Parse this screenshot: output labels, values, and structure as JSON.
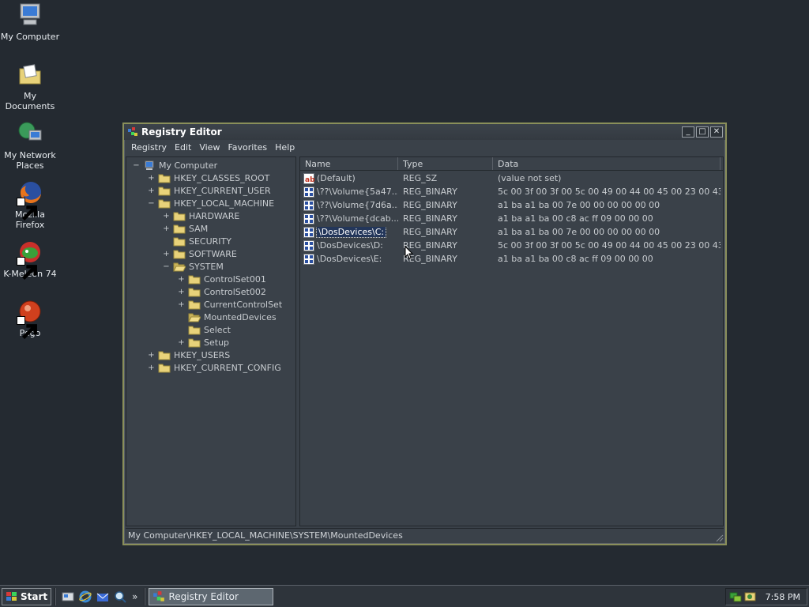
{
  "desktop": {
    "icons": [
      {
        "label": "My Computer",
        "icon": "my-computer-icon"
      },
      {
        "label": "My Documents",
        "icon": "my-documents-icon"
      },
      {
        "label": "My Network Places",
        "icon": "my-network-places-icon"
      },
      {
        "label": "Mozilla Firefox",
        "icon": "firefox-icon"
      },
      {
        "label": "K-Meleon 74",
        "icon": "k-meleon-icon"
      },
      {
        "label": "Pego",
        "icon": "pego-icon"
      }
    ]
  },
  "window": {
    "title": "Registry Editor",
    "menu": [
      "Registry",
      "Edit",
      "View",
      "Favorites",
      "Help"
    ],
    "tree": [
      {
        "label": "My Computer",
        "expander": "−",
        "icon": "computer-icon"
      },
      {
        "label": "HKEY_CLASSES_ROOT",
        "expander": "+",
        "icon": "folder-icon"
      },
      {
        "label": "HKEY_CURRENT_USER",
        "expander": "+",
        "icon": "folder-icon"
      },
      {
        "label": "HKEY_LOCAL_MACHINE",
        "expander": "−",
        "icon": "folder-icon"
      },
      {
        "label": "HARDWARE",
        "expander": "+",
        "icon": "folder-icon"
      },
      {
        "label": "SAM",
        "expander": "+",
        "icon": "folder-icon"
      },
      {
        "label": "SECURITY",
        "expander": "",
        "icon": "folder-icon"
      },
      {
        "label": "SOFTWARE",
        "expander": "+",
        "icon": "folder-icon"
      },
      {
        "label": "SYSTEM",
        "expander": "−",
        "icon": "folder-open-icon"
      },
      {
        "label": "ControlSet001",
        "expander": "+",
        "icon": "folder-icon"
      },
      {
        "label": "ControlSet002",
        "expander": "+",
        "icon": "folder-icon"
      },
      {
        "label": "CurrentControlSet",
        "expander": "+",
        "icon": "folder-icon"
      },
      {
        "label": "MountedDevices",
        "expander": "",
        "icon": "folder-open-icon"
      },
      {
        "label": "Select",
        "expander": "",
        "icon": "folder-icon"
      },
      {
        "label": "Setup",
        "expander": "+",
        "icon": "folder-icon"
      },
      {
        "label": "HKEY_USERS",
        "expander": "+",
        "icon": "folder-icon"
      },
      {
        "label": "HKEY_CURRENT_CONFIG",
        "expander": "+",
        "icon": "folder-icon"
      }
    ],
    "columns": {
      "name": "Name",
      "type": "Type",
      "data": "Data"
    },
    "values": [
      {
        "name": "(Default)",
        "type": "REG_SZ",
        "data": "(value not set)",
        "icon": "string-value-icon"
      },
      {
        "name": "\\??\\Volume{5a47...",
        "type": "REG_BINARY",
        "data": "5c 00 3f 00 3f 00 5c 00 49 00 44 00 45 00 23 00 43 00 ...",
        "icon": "binary-value-icon"
      },
      {
        "name": "\\??\\Volume{7d6a...",
        "type": "REG_BINARY",
        "data": "a1 ba a1 ba 00 7e 00 00 00 00 00 00",
        "icon": "binary-value-icon"
      },
      {
        "name": "\\??\\Volume{dcab...",
        "type": "REG_BINARY",
        "data": "a1 ba a1 ba 00 c8 ac ff 09 00 00 00",
        "icon": "binary-value-icon"
      },
      {
        "name": "\\DosDevices\\C:",
        "type": "REG_BINARY",
        "data": "a1 ba a1 ba 00 7e 00 00 00 00 00 00",
        "icon": "binary-value-icon",
        "selected": true
      },
      {
        "name": "\\DosDevices\\D:",
        "type": "REG_BINARY",
        "data": "5c 00 3f 00 3f 00 5c 00 49 00 44 00 45 00 23 00 43 00 ...",
        "icon": "binary-value-icon"
      },
      {
        "name": "\\DosDevices\\E:",
        "type": "REG_BINARY",
        "data": "a1 ba a1 ba 00 c8 ac ff 09 00 00 00",
        "icon": "binary-value-icon"
      }
    ],
    "status": "My Computer\\HKEY_LOCAL_MACHINE\\SYSTEM\\MountedDevices"
  },
  "taskbar": {
    "start_label": "Start",
    "quicklaunch": [
      "show-desktop-icon",
      "internet-explorer-icon",
      "outlook-express-icon",
      "search-icon"
    ],
    "chevron": "»",
    "task": "Registry Editor",
    "tray_icons": [
      "network-icon",
      "volume-icon"
    ],
    "clock": "7:58 PM"
  }
}
